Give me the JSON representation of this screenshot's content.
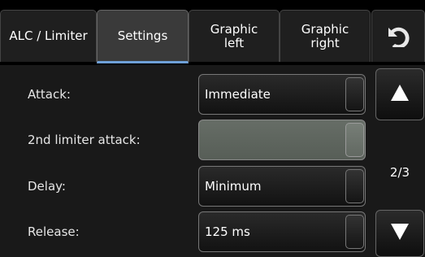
{
  "tabs": [
    {
      "label": "ALC / Limiter",
      "active": false
    },
    {
      "label": "Settings",
      "active": true
    },
    {
      "label": "Graphic\nleft",
      "active": false
    },
    {
      "label": "Graphic\nright",
      "active": false
    }
  ],
  "icons": {
    "undo": "undo-icon",
    "scroll_up": "triangle-up-icon",
    "scroll_down": "triangle-down-icon"
  },
  "settings": [
    {
      "label": "Attack:",
      "value": "Immediate",
      "disabled": false
    },
    {
      "label": "2nd limiter attack:",
      "value": "",
      "disabled": true
    },
    {
      "label": "Delay:",
      "value": "Minimum",
      "disabled": false
    },
    {
      "label": "Release:",
      "value": "125 ms",
      "disabled": false
    }
  ],
  "pagination": {
    "label": "2/3"
  },
  "colors": {
    "active_tab_underline": "#6ea0d8",
    "disabled_field": "#5f665f"
  }
}
